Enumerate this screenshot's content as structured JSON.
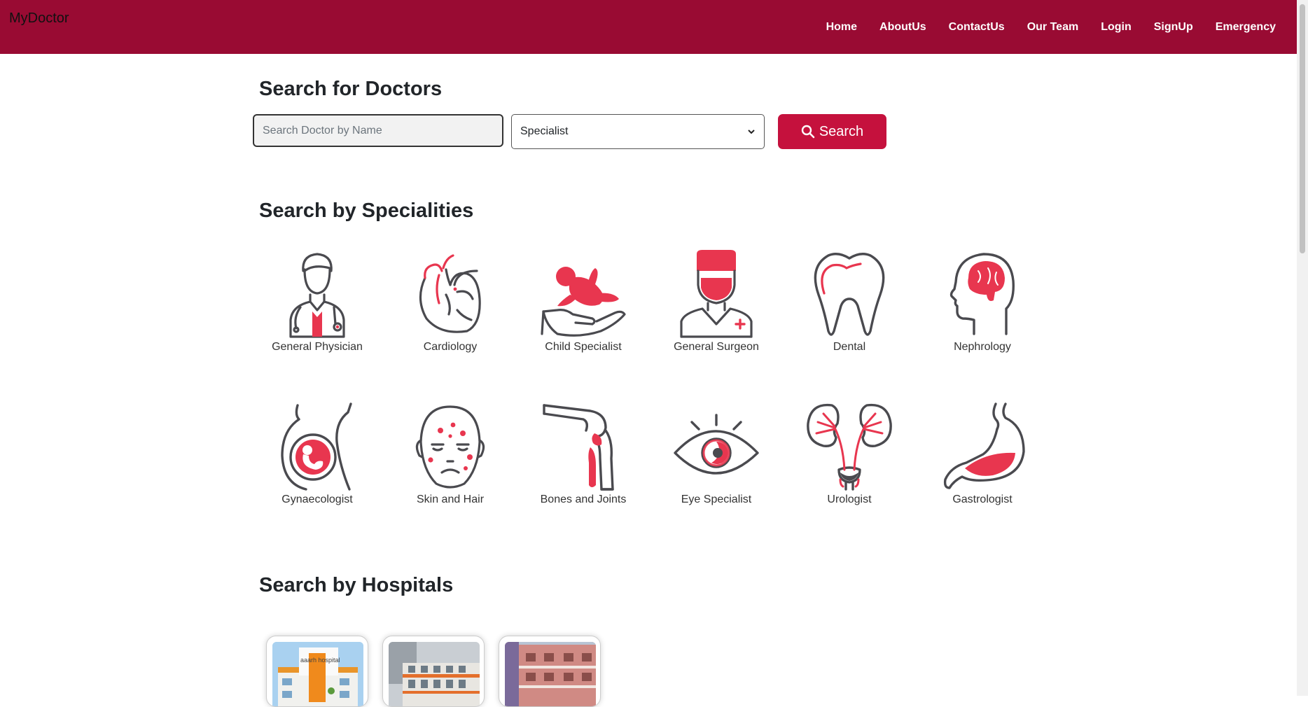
{
  "brand": "MyDoctor",
  "nav": [
    "Home",
    "AboutUs",
    "ContactUs",
    "Our Team",
    "Login",
    "SignUp",
    "Emergency"
  ],
  "search": {
    "heading": "Search for Doctors",
    "placeholder": "Search Doctor by Name",
    "select_value": "Specialist",
    "button_label": "Search"
  },
  "specialities": {
    "heading": "Search by Specialities",
    "items": [
      {
        "label": "General Physician",
        "icon": "doctor-icon"
      },
      {
        "label": "Cardiology",
        "icon": "heart-icon"
      },
      {
        "label": "Child Specialist",
        "icon": "baby-in-hand-icon"
      },
      {
        "label": "General Surgeon",
        "icon": "surgeon-icon"
      },
      {
        "label": "Dental",
        "icon": "tooth-icon"
      },
      {
        "label": "Nephrology",
        "icon": "head-brain-icon"
      },
      {
        "label": "Gynaecologist",
        "icon": "pregnant-icon"
      },
      {
        "label": "Skin and Hair",
        "icon": "face-skin-icon"
      },
      {
        "label": "Bones and Joints",
        "icon": "knee-joint-icon"
      },
      {
        "label": "Eye Specialist",
        "icon": "eye-icon"
      },
      {
        "label": "Urologist",
        "icon": "kidneys-icon"
      },
      {
        "label": "Gastrologist",
        "icon": "stomach-icon"
      }
    ]
  },
  "hospitals": {
    "heading": "Search by Hospitals",
    "sign_text": "aaarh hospital"
  },
  "colors": {
    "navbar": "#990b33",
    "accent": "#c5113d",
    "icon_red": "#e8364f",
    "icon_gray": "#4a4a4f"
  }
}
